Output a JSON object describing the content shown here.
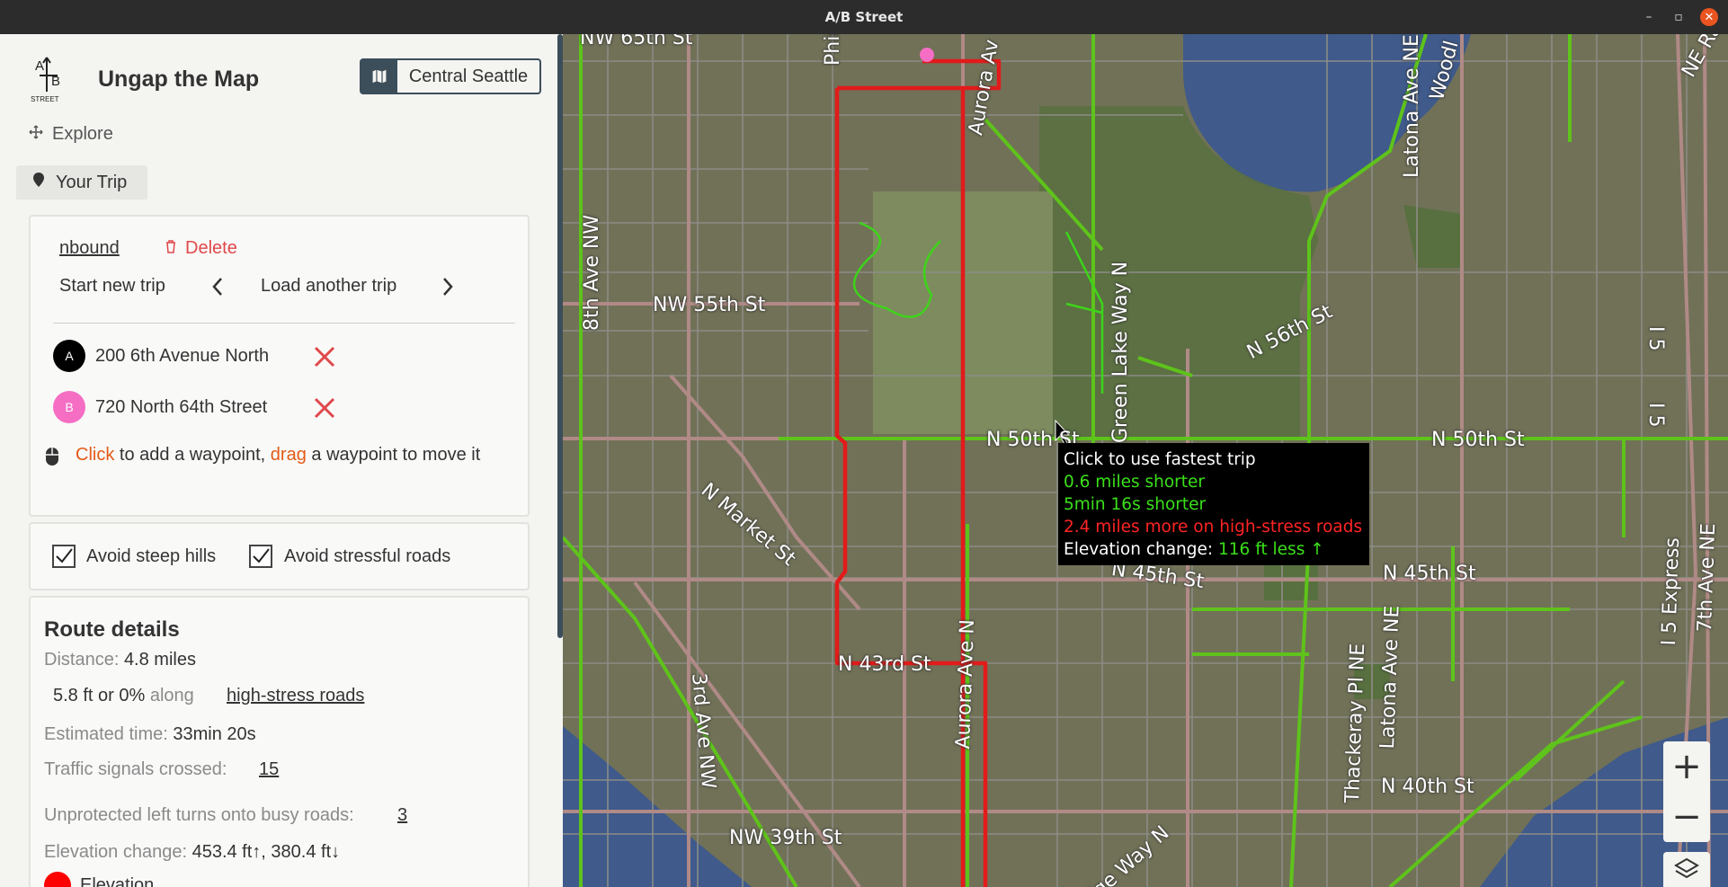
{
  "window": {
    "title": "A/B Street",
    "controls": [
      "–",
      "▫",
      "✕"
    ]
  },
  "logo": {
    "top": "A",
    "sub": "B",
    "caption": "STREET"
  },
  "app": {
    "title": "Ungap the Map",
    "region_button": "Central Seattle",
    "explore_tab": "Explore",
    "trip_tab": "Your Trip"
  },
  "trip": {
    "name_link": "nbound",
    "delete_label": "Delete",
    "start_new": "Start new trip",
    "load_another": "Load another trip",
    "waypoints": [
      {
        "marker": "A",
        "address": "200 6th Avenue North",
        "color": "#000000"
      },
      {
        "marker": "B",
        "address": "720 North 64th Street",
        "color": "#f56ec4"
      }
    ],
    "hint": {
      "click": "Click",
      "part1": " to add a waypoint, ",
      "drag": "drag",
      "part2": " a waypoint to move it"
    },
    "accent_color": "#e35a17"
  },
  "options": {
    "avoid_hills": "Avoid steep hills",
    "avoid_stress": "Avoid stressful roads",
    "avoid_hills_checked": true,
    "avoid_stress_checked": true
  },
  "route": {
    "heading": "Route details",
    "distance_label": "Distance:",
    "distance_value": "4.8 miles",
    "stress_value": "5.8 ft or 0%",
    "stress_along": " along",
    "stress_link": "high-stress roads",
    "time_label": "Estimated time:",
    "time_value": "33min 20s",
    "signals_label": "Traffic signals crossed:",
    "signals_value": "15",
    "left_turns_label": "Unprotected left turns onto busy roads:",
    "left_turns_value": "3",
    "elevation_label": "Elevation change:",
    "elevation_value": "453.4 ft↑, 380.4 ft↓",
    "elevation_legend": "Elevation",
    "elevation_color": "#ff0000"
  },
  "map": {
    "streets": {
      "nw65": "NW 65th St",
      "phin": "Phin",
      "aurora_top": "Aurora Av",
      "eighth": "8th Ave NW",
      "nw55": "NW 55th St",
      "greenlake": "Green Lake Way N",
      "n56": "N 56th St",
      "latona_top": "Latona Ave NE",
      "n50_a": "N 50th St",
      "n50_b": "N 50th St",
      "market": "N Market St",
      "n45_a": "N 45th St",
      "n45_b": "N 45th St",
      "aurora_ave": "Aurora Ave N",
      "n43": "N 43rd St",
      "third": "3rd Ave NW",
      "thackeray": "Thackeray Pl NE",
      "latona_bot": "Latona Ave NE",
      "i5exp": "I 5 Express",
      "seventh": "7th Ave NE",
      "i5a": "I 5",
      "i5b": "I 5",
      "n40": "N 40th St",
      "nw39": "NW 39th St",
      "ridge": "idge Way N",
      "woodl": "Woodl",
      "ravenna": "NE Ravenna"
    },
    "tooltip": {
      "line1": "Click to use fastest trip",
      "line2": "0.6 miles shorter",
      "line3": "5min 16s shorter",
      "line4": "2.4 miles more on high-stress roads",
      "line5_label": "Elevation change: ",
      "line5_value": "116 ft less ↑"
    },
    "zoom_in": "+",
    "zoom_out": "−"
  }
}
